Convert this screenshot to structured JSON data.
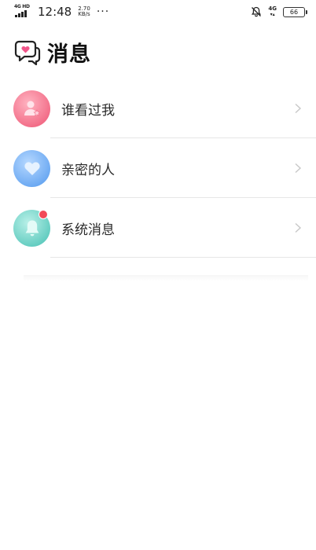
{
  "status_bar": {
    "network_left": "4G HD",
    "time": "12:48",
    "speed_value": "2.70",
    "speed_unit": "KB/s",
    "overflow": "···",
    "network_right": "4G",
    "battery": "66"
  },
  "header": {
    "icon": "chat-heart-icon",
    "title": "消息"
  },
  "list": [
    {
      "label": "谁看过我",
      "icon": "person-star-icon",
      "color": "#f26b86",
      "badge": false
    },
    {
      "label": "亲密的人",
      "icon": "heart-icon",
      "color": "#6aa8f2",
      "badge": false
    },
    {
      "label": "系统消息",
      "icon": "bell-icon",
      "color": "#62ccc0",
      "badge": true
    }
  ],
  "colors": {
    "badge": "#f24a58",
    "divider": "#e6e6e6"
  }
}
